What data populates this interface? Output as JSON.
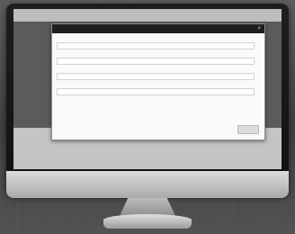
{
  "page": {
    "header_title": "",
    "footer_line1": "",
    "footer_line2": ""
  },
  "modal": {
    "title": "",
    "close_icon": "×",
    "submit_label": ""
  },
  "form": {
    "fields": [
      {
        "label": "",
        "placeholder": ""
      },
      {
        "label": "",
        "placeholder": ""
      },
      {
        "label": "",
        "placeholder": ""
      },
      {
        "label": "",
        "placeholder": ""
      }
    ]
  }
}
